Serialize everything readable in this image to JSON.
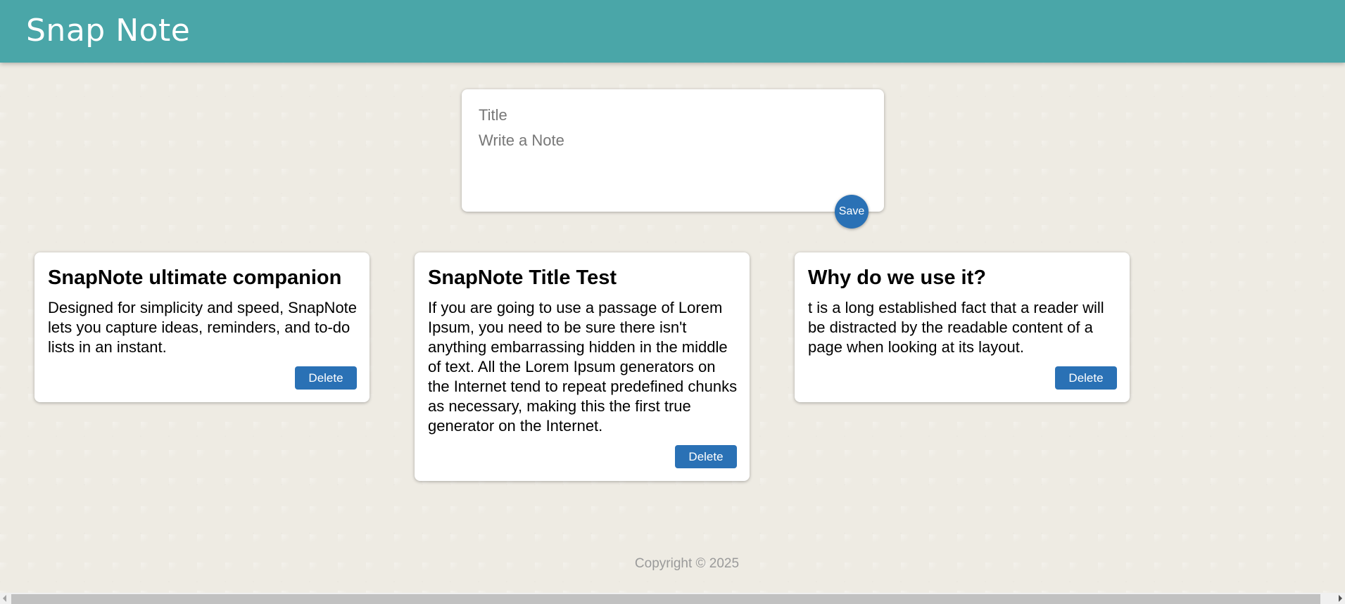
{
  "header": {
    "brand": "Snap Note"
  },
  "composer": {
    "title_placeholder": "Title",
    "note_placeholder": "Write a Note",
    "title_value": "",
    "note_value": "",
    "save_label": "Save"
  },
  "notes": [
    {
      "title": "SnapNote ultimate companion",
      "body": "Designed for simplicity and speed, SnapNote lets you capture ideas, reminders, and to-do lists in an instant.",
      "delete_label": "Delete"
    },
    {
      "title": "SnapNote Title Test",
      "body": "If you are going to use a passage of Lorem Ipsum, you need to be sure there isn't anything embarrassing hidden in the middle of text. All the Lorem Ipsum generators on the Internet tend to repeat predefined chunks as necessary, making this the first true generator on the Internet.",
      "delete_label": "Delete"
    },
    {
      "title": "Why do we use it?",
      "body": "t is a long established fact that a reader will be distracted by the readable content of a page when looking at its layout.",
      "delete_label": "Delete"
    }
  ],
  "footer": {
    "copyright": "Copyright © 2025"
  },
  "colors": {
    "header": "#4aa6a8",
    "accent": "#2a71b5",
    "background": "#eeebe3"
  }
}
